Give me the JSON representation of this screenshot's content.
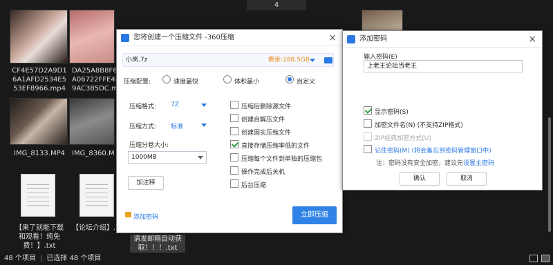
{
  "explorer": {
    "page_number": "4",
    "tiles": [
      {
        "label": "CF4E57D2A9D1\n6A1AFD2534E5\n53EF8966.mp4"
      },
      {
        "label": "DA25A8B8F6\nA06722FFE4F\n9AC385DC.m"
      },
      {
        "label": "IMG_8133.MP4"
      },
      {
        "label": "IMG_8360.M"
      },
      {
        "label": "【来了就能下载\n和观看！纯免\n费！】.txt"
      },
      {
        "label": "【论坛介绍】.t"
      },
      {
        "label": "请发邮箱自动获\n取！！！.txt"
      }
    ],
    "status": {
      "count": "48 个项目",
      "selected": "已选择 48 个项目"
    }
  },
  "compress_dialog": {
    "title": "您将创建一个压缩文件 -360压缩",
    "close": "×",
    "filename": "小岚.7z",
    "free_space": "剩余:288.5GB",
    "config_label": "压缩配置:",
    "config_options": [
      "速度最快",
      "体积最小",
      "自定义"
    ],
    "format_label": "压缩格式:",
    "format_value": "7Z",
    "method_label": "压缩方式:",
    "method_value": "标准",
    "split_label": "压缩分卷大小:",
    "split_value": "1000MB",
    "comment_button": "加注释",
    "options": [
      {
        "label": "压缩后删除源文件",
        "checked": false
      },
      {
        "label": "创建自解压文件",
        "checked": false
      },
      {
        "label": "创建固实压缩文件",
        "checked": false
      },
      {
        "label": "直接存储压缩率低的文件",
        "checked": true
      },
      {
        "label": "压缩每个文件到单独的压缩包",
        "checked": false
      },
      {
        "label": "操作完成后关机",
        "checked": false
      },
      {
        "label": "后台压缩",
        "checked": false
      }
    ],
    "add_password": "添加密码",
    "compress_now": "立即压缩"
  },
  "password_dialog": {
    "title": "添加密码",
    "close": "×",
    "input_label": "输入密码(E)",
    "password_value": "上老王论坛当老王",
    "show_password": "显示密码(S)",
    "encrypt_names": "加密文件名(N) (不支持ZIP格式)",
    "zip_classic": "ZIP经典加密方式(U)",
    "remember_password": "记住密码(M) (将会备忘到密码管理窗口中)",
    "note_prefix": "注：密码没有安全加密，建议先",
    "note_link": "设置主密码",
    "ok": "确认",
    "cancel": "取消"
  }
}
